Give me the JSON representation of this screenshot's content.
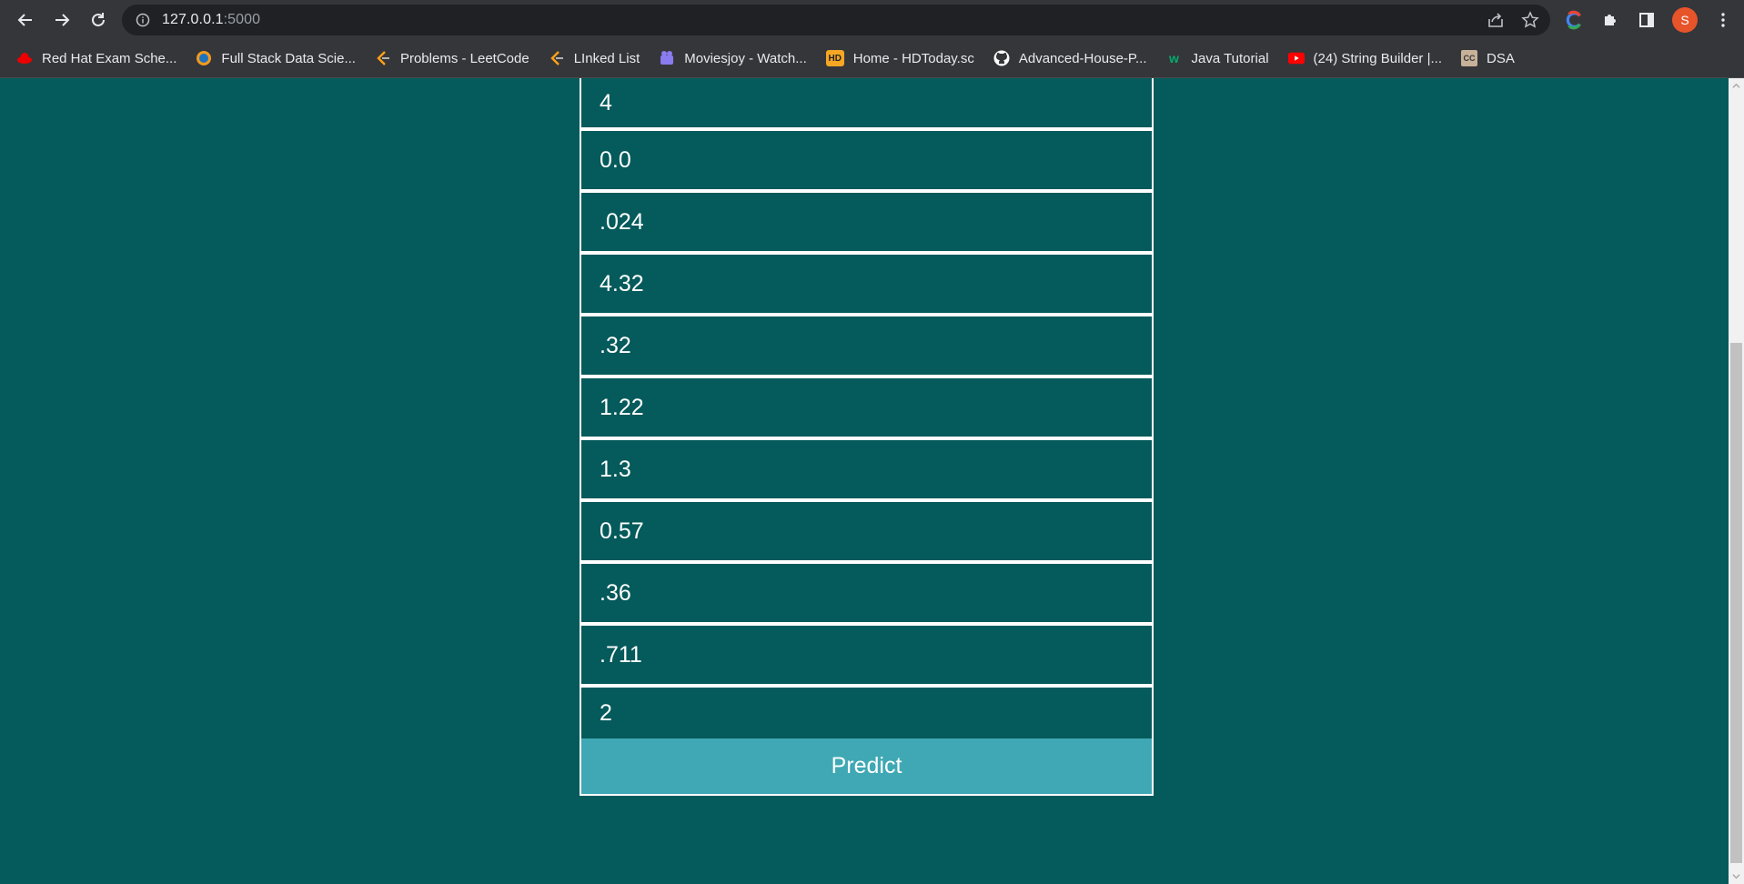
{
  "browser": {
    "url_host": "127.0.0.1",
    "url_port": ":5000",
    "avatar_letter": "S"
  },
  "bookmarks": [
    {
      "label": "Red Hat Exam Sche...",
      "icon": "redhat-icon"
    },
    {
      "label": "Full Stack Data Scie...",
      "icon": "globe-icon"
    },
    {
      "label": "Problems - LeetCode",
      "icon": "leetcode-icon"
    },
    {
      "label": "LInked List",
      "icon": "leetcode-icon"
    },
    {
      "label": "Moviesjoy - Watch...",
      "icon": "movie-icon"
    },
    {
      "label": "Home - HDToday.sc",
      "icon": "hd-icon"
    },
    {
      "label": "Advanced-House-P...",
      "icon": "github-icon"
    },
    {
      "label": "Java Tutorial",
      "icon": "w3-icon"
    },
    {
      "label": "(24) String Builder |...",
      "icon": "youtube-icon"
    },
    {
      "label": "DSA",
      "icon": "cc-icon"
    }
  ],
  "form": {
    "fields": [
      "4",
      "0.0",
      ".024",
      "4.32",
      ".32",
      "1.22",
      "1.3",
      "0.57",
      ".36",
      ".711",
      "2"
    ],
    "predict_label": "Predict"
  },
  "colors": {
    "page_bg": "#055a5b",
    "button_bg": "#3fa8b4",
    "chrome_bg": "#35363a"
  }
}
